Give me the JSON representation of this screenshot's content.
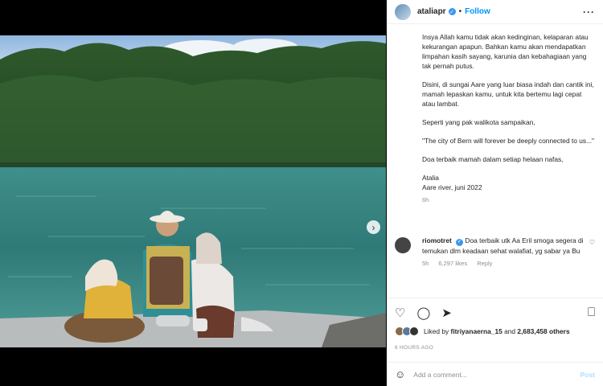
{
  "header": {
    "username": "ataliapr",
    "separator": "•",
    "follow_label": "Follow",
    "more_icon": "more-horizontal-icon"
  },
  "caption": {
    "paragraphs": [
      "Insya Allah kamu tidak akan kedinginan, kelaparan atau kekurangan apapun. Bahkan kamu akan mendapatkan limpahan kasih sayang, karunia dan kebahagiaan yang tak pernah putus.",
      "Disini, di sungai Aare yang luar biasa indah dan cantik ini, mamah lepaskan kamu, untuk kita bertemu lagi cepat atau lambat.",
      "Seperti yang pak walikota sampaikan,",
      "\"The city of Bern will forever be deeply connected to us...\"",
      "Doa terbaik mamah dalam setiap helaan nafas,"
    ],
    "signature_name": "Atalia",
    "signature_place": "Aare river, juni 2022",
    "time": "6h"
  },
  "comment": {
    "username": "riomotret",
    "text": "Doa terbaik utk Aa Eril smoga segera di temukan dlm keadaan sehat walafiat, yg sabar ya Bu",
    "time": "5h",
    "likes": "6,297 likes",
    "reply": "Reply"
  },
  "likes": {
    "prefix": "Liked by",
    "user": "fitriyanaerna_15",
    "conj": "and",
    "others": "2,683,458 others"
  },
  "posted_ago": "6 HOURS AGO",
  "add_comment": {
    "placeholder": "Add a comment...",
    "post_label": "Post"
  },
  "colors": {
    "accent": "#0095f6",
    "verified": "#3897f0"
  }
}
